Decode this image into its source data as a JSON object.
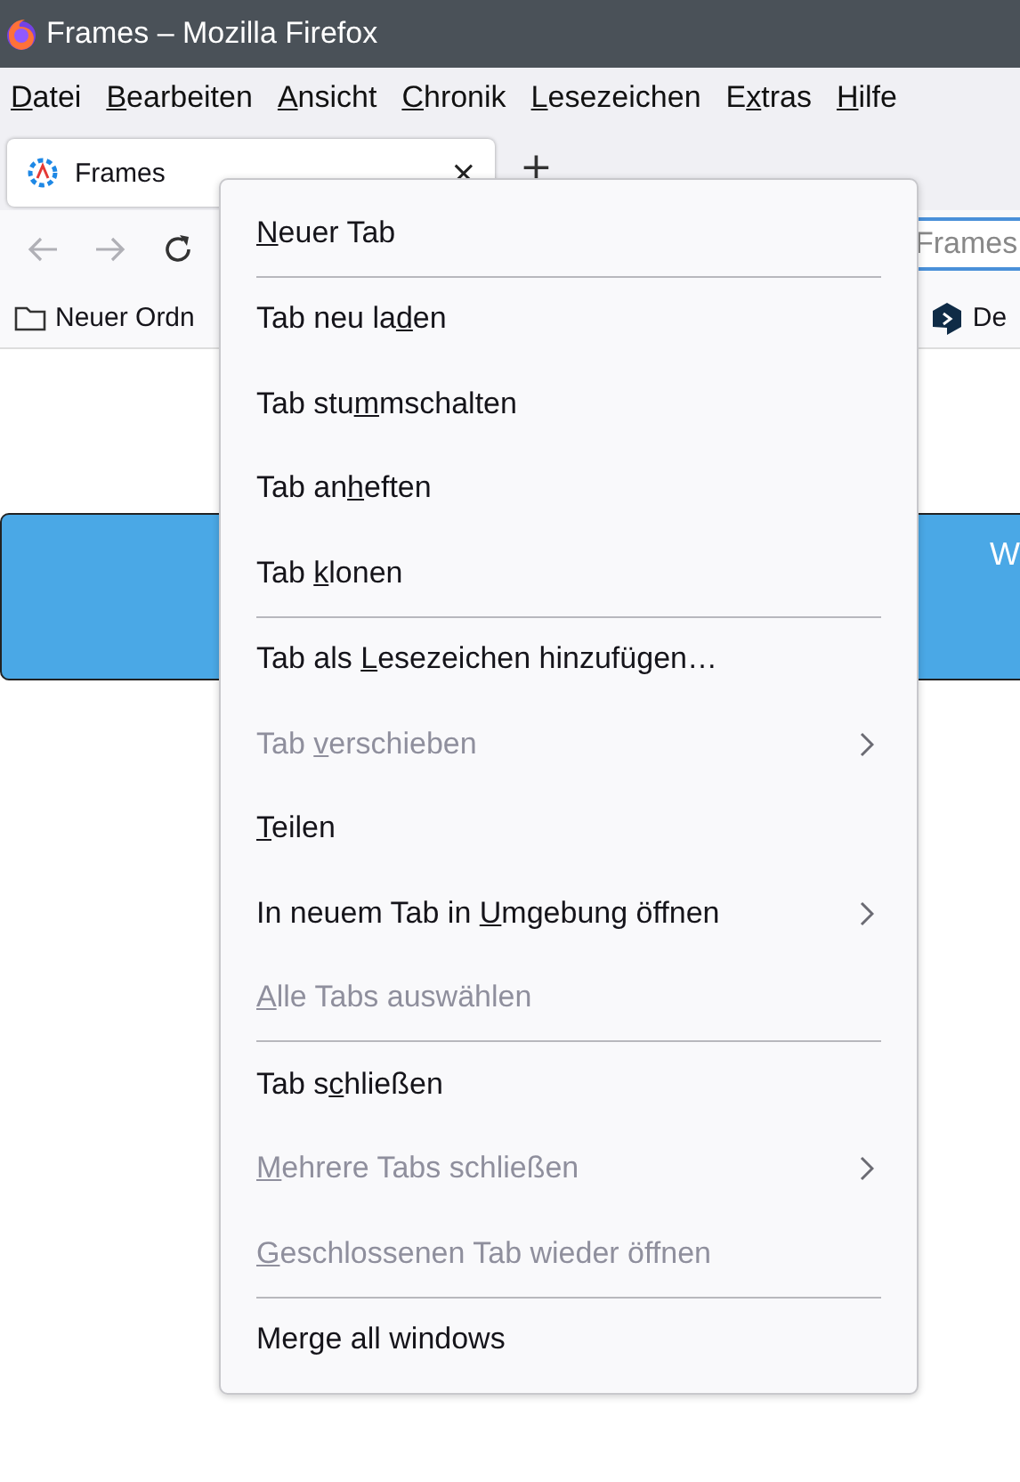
{
  "window": {
    "title": "Frames – Mozilla Firefox"
  },
  "menubar": [
    {
      "access_key": "D",
      "post": "atei"
    },
    {
      "access_key": "B",
      "post": "earbeiten"
    },
    {
      "access_key": "A",
      "post": "nsicht"
    },
    {
      "access_key": "C",
      "post": "hronik"
    },
    {
      "access_key": "L",
      "post": "esezeichen"
    },
    {
      "pre": "E",
      "access_key": "x",
      "post": "tras"
    },
    {
      "access_key": "H",
      "post": "ilfe"
    }
  ],
  "tabs": [
    {
      "label": "Frames",
      "selected": true,
      "close": "×"
    }
  ],
  "new_tab": "+",
  "address_bar": {
    "value": "Frames"
  },
  "bookmarks": [
    {
      "label": "Neuer Ordn",
      "kind": "folder"
    },
    {
      "label": "De",
      "kind": "site"
    }
  ],
  "page": {
    "banner": {
      "text": "W"
    }
  },
  "context_menu": [
    {
      "kind": "item",
      "access_key": "N",
      "post": "euer Tab",
      "disabled": false,
      "submenu": false
    },
    {
      "kind": "separator"
    },
    {
      "kind": "item",
      "pre": "Tab neu la",
      "access_key": "d",
      "post": "en",
      "disabled": false,
      "submenu": false
    },
    {
      "kind": "item",
      "pre": "Tab stu",
      "access_key": "m",
      "post": "mschalten",
      "disabled": false,
      "submenu": false
    },
    {
      "kind": "item",
      "pre": "Tab an",
      "access_key": "h",
      "post": "eften",
      "disabled": false,
      "submenu": false
    },
    {
      "kind": "item",
      "pre": "Tab ",
      "access_key": "k",
      "post": "lonen",
      "disabled": false,
      "submenu": false
    },
    {
      "kind": "separator"
    },
    {
      "kind": "item",
      "pre": "Tab als ",
      "access_key": "L",
      "post": "esezeichen hinzufügen…",
      "disabled": false,
      "submenu": false
    },
    {
      "kind": "item",
      "pre": "Tab ",
      "access_key": "v",
      "post": "erschieben",
      "disabled": true,
      "submenu": true
    },
    {
      "kind": "item",
      "access_key": "T",
      "post": "eilen",
      "disabled": false,
      "submenu": false
    },
    {
      "kind": "item",
      "pre": "In neuem Tab in ",
      "access_key": "U",
      "post": "mgebung öffnen",
      "disabled": false,
      "submenu": true
    },
    {
      "kind": "item",
      "access_key": "A",
      "post": "lle Tabs auswählen",
      "disabled": true,
      "submenu": false
    },
    {
      "kind": "separator"
    },
    {
      "kind": "item",
      "pre": "Tab s",
      "access_key": "c",
      "post": "hließen",
      "disabled": false,
      "submenu": false
    },
    {
      "kind": "item",
      "access_key": "M",
      "post": "ehrere Tabs schließen",
      "disabled": true,
      "submenu": true
    },
    {
      "kind": "item",
      "access_key": "G",
      "post": "eschlossenen Tab wieder öffnen",
      "disabled": true,
      "submenu": false
    },
    {
      "kind": "separator"
    },
    {
      "kind": "item",
      "pre": "Merge all windows",
      "disabled": false,
      "submenu": false
    }
  ]
}
